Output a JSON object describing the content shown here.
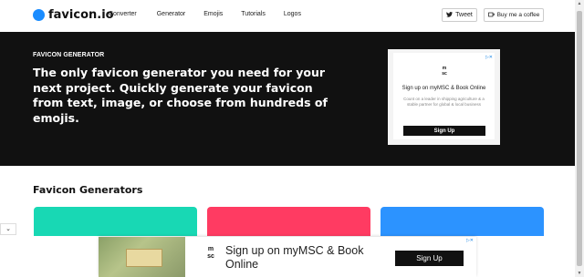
{
  "header": {
    "logo_text": "favicon.io",
    "nav": [
      "Converter",
      "Generator",
      "Emojis",
      "Tutorials",
      "Logos"
    ],
    "tweet_label": "Tweet",
    "coffee_label": "Buy me a coffee"
  },
  "hero": {
    "eyebrow": "FAVICON GENERATOR",
    "title": "The only favicon generator you need for your next project. Quickly generate your favicon from text, image, or choose from hundreds of emojis."
  },
  "hero_ad": {
    "brand_line1": "m",
    "brand_line2": "sc",
    "headline": "Sign up on myMSC & Book Online",
    "body": "Count on a leader in shipping agriculture & a stable partner for global & local business",
    "button": "Sign Up"
  },
  "section": {
    "title": "Favicon Generators"
  },
  "bottom_ad": {
    "brand_line1": "m",
    "brand_line2": "sc",
    "headline": "Sign up on myMSC & Book Online",
    "button": "Sign Up"
  },
  "colors": {
    "accent": "#1a8cff",
    "card_green": "#18d8b4",
    "card_red": "#ff3b62",
    "card_blue": "#2c93ff",
    "hero_bg": "#111111"
  }
}
